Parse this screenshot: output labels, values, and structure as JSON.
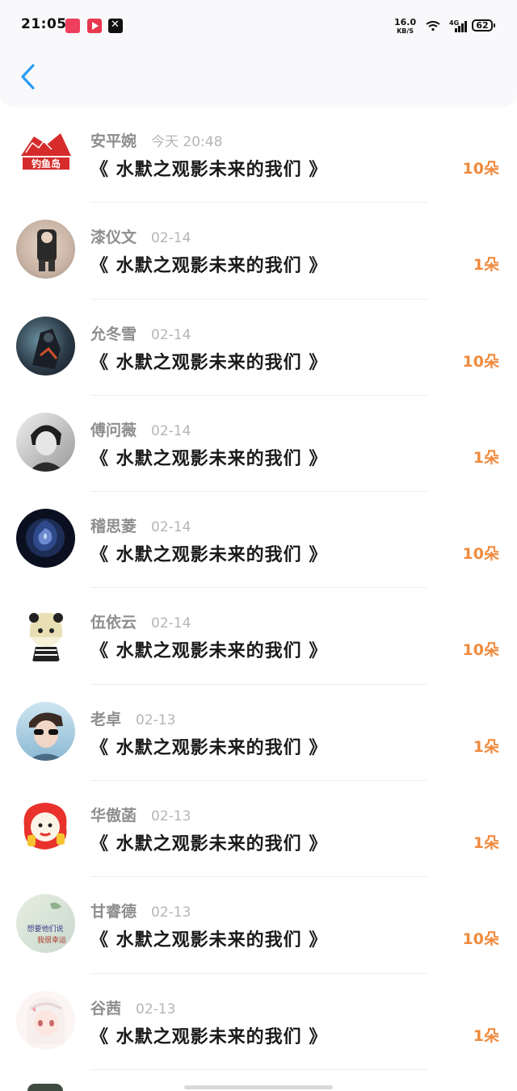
{
  "status_bar": {
    "time": "21:05",
    "net_speed": "16.0",
    "net_unit": "KB/S",
    "network": "4G",
    "battery": "62"
  },
  "header": {
    "back_icon": "chevron-left-icon",
    "accent": "#2a9bf0"
  },
  "colors": {
    "count": "#f08a3c",
    "name": "#8e8e8e",
    "date": "#b5b5b5"
  },
  "items": [
    {
      "name": "安平婉",
      "date": "今天 20:48",
      "title": "《 水默之观影未来的我们 》",
      "count": "10朵"
    },
    {
      "name": "漆仪文",
      "date": "02-14",
      "title": "《 水默之观影未来的我们 》",
      "count": "1朵"
    },
    {
      "name": "允冬雪",
      "date": "02-14",
      "title": "《 水默之观影未来的我们 》",
      "count": "10朵"
    },
    {
      "name": "傅问薇",
      "date": "02-14",
      "title": "《 水默之观影未来的我们 》",
      "count": "1朵"
    },
    {
      "name": "稽思菱",
      "date": "02-14",
      "title": "《 水默之观影未来的我们 》",
      "count": "10朵"
    },
    {
      "name": "伍依云",
      "date": "02-14",
      "title": "《 水默之观影未来的我们 》",
      "count": "10朵"
    },
    {
      "name": "老卓",
      "date": "02-13",
      "title": "《 水默之观影未来的我们 》",
      "count": "1朵"
    },
    {
      "name": "华傲菡",
      "date": "02-13",
      "title": "《 水默之观影未来的我们 》",
      "count": "1朵"
    },
    {
      "name": "甘睿德",
      "date": "02-13",
      "title": "《 水默之观影未来的我们 》",
      "count": "10朵"
    },
    {
      "name": "谷茜",
      "date": "02-13",
      "title": "《 水默之观影未来的我们 》",
      "count": "1朵"
    }
  ],
  "avatar_texts": {
    "first_avatar_text": "钓鱼岛",
    "ninth_avatar_line1": "想要他们说",
    "ninth_avatar_line2": "我很幸运"
  }
}
